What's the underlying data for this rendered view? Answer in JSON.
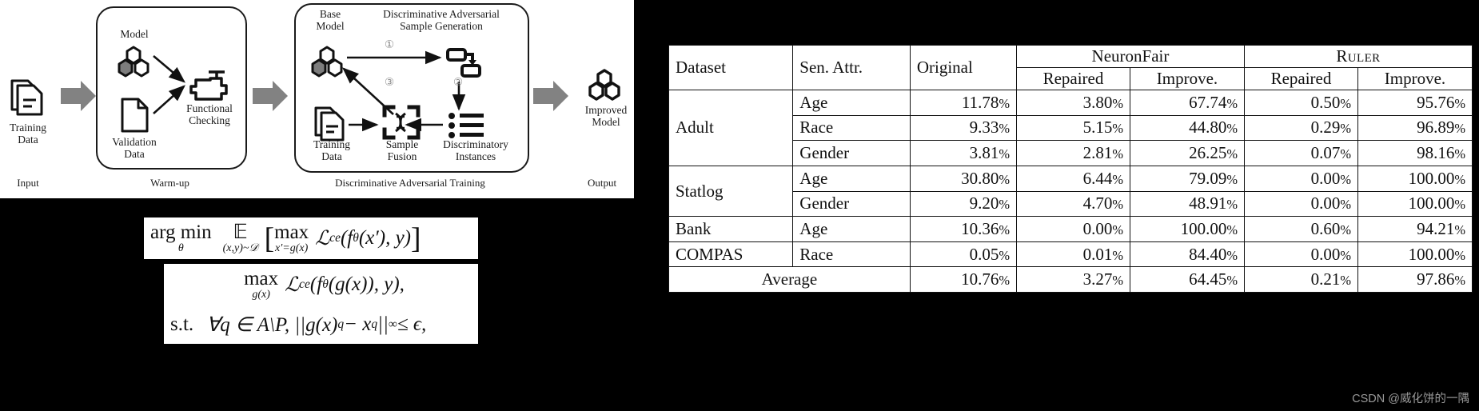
{
  "figure": {
    "input": {
      "icon": "documents-icon",
      "label_line1": "Training",
      "label_line2": "Data",
      "caption": "Input"
    },
    "warmup": {
      "caption": "Warm-up",
      "model_label": "Model",
      "model_icon": "hexagon-cluster-icon",
      "validation_label_line1": "Validation",
      "validation_label_line2": "Data",
      "validation_icon": "document-icon",
      "check_label_line1": "Functional",
      "check_label_line2": "Checking",
      "check_icon": "engine-check-icon"
    },
    "training": {
      "caption": "Discriminative Adversarial Training",
      "base_model_line1": "Base",
      "base_model_line2": "Model",
      "base_model_icon": "hexagon-cluster-icon",
      "dasg_line1": "Discriminative Adversarial",
      "dasg_line2": "Sample Generation",
      "dasg_icon": "flow-blocks-icon",
      "step1": "①",
      "step2": "②",
      "step3": "③",
      "training_data_line1": "Training",
      "training_data_line2": "Data",
      "training_data_icon": "documents-icon",
      "fusion_line1": "Sample",
      "fusion_line2": "Fusion",
      "fusion_icon": "dna-crop-icon",
      "instances_line1": "Discriminatory",
      "instances_line2": "Instances",
      "instances_icon": "bullet-list-icon"
    },
    "output": {
      "icon": "hexagon-cluster-icon",
      "label_line1": "Improved",
      "label_line2": "Model",
      "caption": "Output"
    }
  },
  "formulas": {
    "line1": {
      "argmin": "arg min",
      "argmin_sub": "θ",
      "expect": "𝔼",
      "expect_sub": "(x,y)~𝒟",
      "bracket_open": "[",
      "max": "max",
      "max_sub": "x′=g(x)",
      "loss": "ℒ",
      "loss_sub": "ce",
      "body": "(f",
      "body_sub": "θ",
      "body_rest": "(x′), y)",
      "bracket_close": "]"
    },
    "line2": {
      "max": "max",
      "max_sub": "g(x)",
      "loss": "ℒ",
      "loss_sub": "ce",
      "body": "(f",
      "body_sub": "θ",
      "body_rest": "(g(x)), y),"
    },
    "line3": {
      "st": "s.t.",
      "body": "∀q ∈ A\\P,  ||g(x)",
      "body_sub1": "q",
      "body_mid": " − x",
      "body_sub2": "q",
      "body_rest": "||",
      "body_sub3": "∞",
      "body_tail": " ≤ ϵ,"
    }
  },
  "table": {
    "headers": {
      "dataset": "Dataset",
      "sen_attr": "Sen. Attr.",
      "original": "Original",
      "group_neuronfair": "NeuronFair",
      "group_ruler": "Ruler",
      "sub_repaired": "Repaired",
      "sub_improve": "Improve."
    },
    "groups": [
      {
        "dataset": "Adult",
        "rows": [
          {
            "attr": "Age",
            "original": "11.78%",
            "nf_repaired": "3.80%",
            "nf_improve": "67.74%",
            "ruler_repaired": "0.50%",
            "ruler_improve": "95.76%",
            "nf_repaired_bold": false,
            "nf_improve_bold": false,
            "ruler_repaired_bold": true,
            "ruler_improve_bold": true
          },
          {
            "attr": "Race",
            "original": "9.33%",
            "nf_repaired": "5.15%",
            "nf_improve": "44.80%",
            "ruler_repaired": "0.29%",
            "ruler_improve": "96.89%",
            "nf_repaired_bold": false,
            "nf_improve_bold": false,
            "ruler_repaired_bold": true,
            "ruler_improve_bold": true
          },
          {
            "attr": "Gender",
            "original": "3.81%",
            "nf_repaired": "2.81%",
            "nf_improve": "26.25%",
            "ruler_repaired": "0.07%",
            "ruler_improve": "98.16%",
            "nf_repaired_bold": false,
            "nf_improve_bold": false,
            "ruler_repaired_bold": true,
            "ruler_improve_bold": true
          }
        ]
      },
      {
        "dataset": "Statlog",
        "rows": [
          {
            "attr": "Age",
            "original": "30.80%",
            "nf_repaired": "6.44%",
            "nf_improve": "79.09%",
            "ruler_repaired": "0.00%",
            "ruler_improve": "100.00%",
            "nf_repaired_bold": false,
            "nf_improve_bold": false,
            "ruler_repaired_bold": true,
            "ruler_improve_bold": true
          },
          {
            "attr": "Gender",
            "original": "9.20%",
            "nf_repaired": "4.70%",
            "nf_improve": "48.91%",
            "ruler_repaired": "0.00%",
            "ruler_improve": "100.00%",
            "nf_repaired_bold": false,
            "nf_improve_bold": false,
            "ruler_repaired_bold": true,
            "ruler_improve_bold": true
          }
        ]
      },
      {
        "dataset": "Bank",
        "rows": [
          {
            "attr": "Age",
            "original": "10.36%",
            "nf_repaired": "0.00%",
            "nf_improve": "100.00%",
            "ruler_repaired": "0.60%",
            "ruler_improve": "94.21%",
            "nf_repaired_bold": true,
            "nf_improve_bold": true,
            "ruler_repaired_bold": false,
            "ruler_improve_bold": false
          }
        ]
      },
      {
        "dataset": "COMPAS",
        "rows": [
          {
            "attr": "Race",
            "original": "0.05%",
            "nf_repaired": "0.01%",
            "nf_improve": "84.40%",
            "ruler_repaired": "0.00%",
            "ruler_improve": "100.00%",
            "nf_repaired_bold": false,
            "nf_improve_bold": false,
            "ruler_repaired_bold": true,
            "ruler_improve_bold": true
          }
        ]
      }
    ],
    "average": {
      "label": "Average",
      "original": "10.76%",
      "nf_repaired": "3.27%",
      "nf_improve": "64.45%",
      "ruler_repaired": "0.21%",
      "ruler_improve": "97.86%",
      "ruler_repaired_bold": true,
      "ruler_improve_bold": true
    }
  },
  "watermark": "CSDN @威化饼的一隅",
  "colors": {
    "background": "#000000",
    "panel": "#ffffff",
    "ink": "#111111",
    "arrow_grey": "#828282",
    "hex_fill_grey": "#7d7d7d",
    "watermark": "#9a9a9a"
  }
}
